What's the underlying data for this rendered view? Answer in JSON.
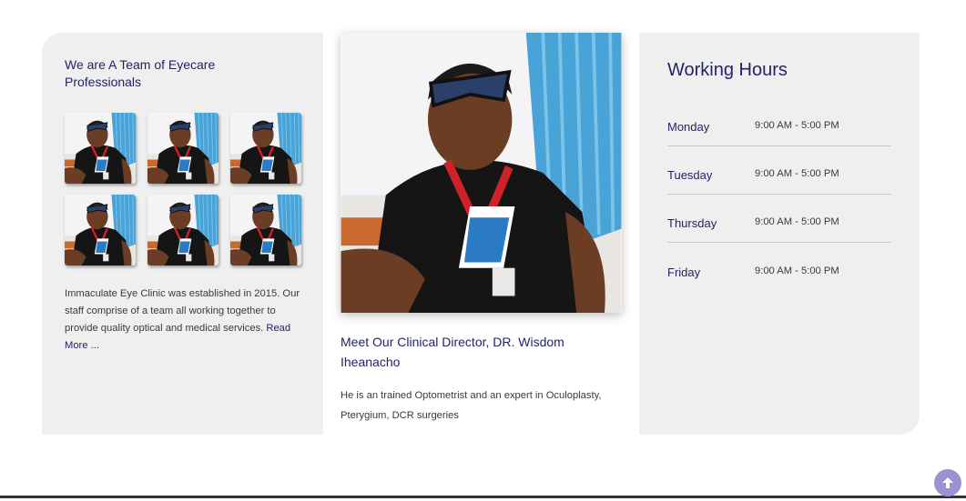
{
  "team_card": {
    "title": "We are A Team of Eyecare Professionals",
    "about_text": "Immaculate Eye Clinic was established in 2015. Our staff comprise of a team all working together to provide quality optical and medical services.",
    "read_more": "Read More ..."
  },
  "director": {
    "title": "Meet Our Clinical Director, DR. Wisdom Iheanacho",
    "description": "He is an trained Optometrist and an expert in Oculoplasty, Pterygium, DCR surgeries"
  },
  "hours": {
    "title": "Working Hours",
    "rows": [
      {
        "day": "Monday",
        "time": "9:00 AM - 5:00 PM"
      },
      {
        "day": "Tuesday",
        "time": "9:00 AM - 5:00 PM"
      },
      {
        "day": "Thursday",
        "time": "9:00 AM - 5:00 PM"
      },
      {
        "day": "Friday",
        "time": "9:00 AM - 5:00 PM"
      }
    ]
  },
  "scroll_top_icon": "arrow-up-icon"
}
